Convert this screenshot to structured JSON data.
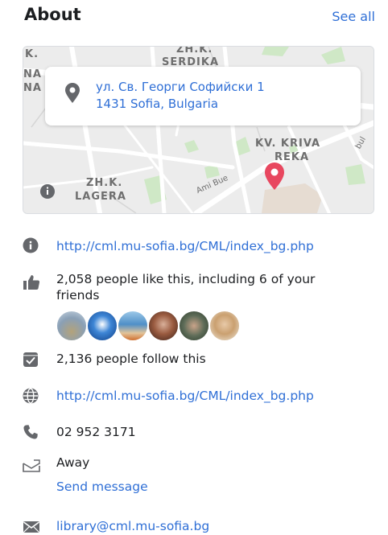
{
  "header": {
    "title": "About",
    "see_all": "See all"
  },
  "map": {
    "labels": {
      "k": "K.",
      "na1": "NA",
      "na2": "NA",
      "zhk_top": "ZH.K.",
      "serdika": "SERDIKA",
      "kv_kriva": "KV. KRIVA",
      "reka": "REKA",
      "zhk": "ZH.K.",
      "lagera": "LAGERA",
      "amibue": "Ami Bue",
      "bul": "bul"
    },
    "address_line1": "ул. Св. Георги Софийски 1",
    "address_line2": "1431 Sofia, Bulgaria"
  },
  "rows": {
    "website1": "http://cml.mu-sofia.bg/CML/index_bg.php",
    "likes_line1": "2,058 people like this, including 6 of your",
    "likes_line2": "friends",
    "follows": "2,136 people follow this",
    "website2": "http://cml.mu-sofia.bg/CML/index_bg.php",
    "phone": "02 952 3171",
    "status": "Away",
    "send_message": "Send message",
    "email": "library@cml.mu-sofia.bg"
  },
  "colors": {
    "link": "#2f6fd6",
    "icon": "#65676b",
    "pin_red": "#e8475f"
  }
}
